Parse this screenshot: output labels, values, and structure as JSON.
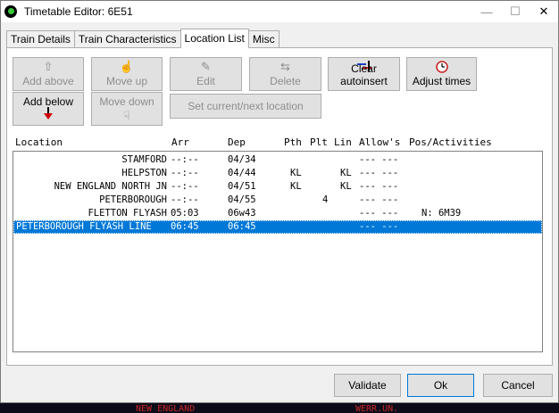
{
  "window": {
    "title": "Timetable Editor: 6E51",
    "controls": {
      "minimize": "—",
      "maximize": "☐",
      "close": "✕"
    }
  },
  "tabs": [
    {
      "label": "Train Details",
      "active": false
    },
    {
      "label": "Train Characteristics",
      "active": false
    },
    {
      "label": "Location List",
      "active": true
    },
    {
      "label": "Misc",
      "active": false
    }
  ],
  "toolbar": {
    "add_above": {
      "label": "Add above",
      "icon": "arrow-up-icon",
      "enabled": false
    },
    "add_below": {
      "label": "Add below",
      "icon": "arrow-down-red-icon",
      "enabled": true
    },
    "move_up": {
      "label": "Move up",
      "icon": "hand-up-icon",
      "enabled": false
    },
    "move_down": {
      "label": "Move down",
      "icon": "hand-down-icon",
      "enabled": false
    },
    "edit": {
      "label": "Edit",
      "icon": "edit-document-icon",
      "enabled": false
    },
    "delete": {
      "label": "Delete",
      "icon": "delete-icon",
      "enabled": false
    },
    "clear_autoinsert": {
      "label": "Clear autoinsert",
      "icon": "clear-autoinsert-icon",
      "enabled": true
    },
    "adjust_times": {
      "label": "Adjust times",
      "icon": "clock-icon",
      "enabled": true
    },
    "set_current_next": {
      "label": "Set current/next location",
      "enabled": false
    }
  },
  "columns": [
    "Location",
    "Arr",
    "Dep",
    "Pth",
    "Plt",
    "Lin",
    "Allow's",
    "Pos/Activities"
  ],
  "rows": [
    {
      "location": "STAMFORD",
      "arr": "--:--",
      "dep": "04/34",
      "pth": "",
      "plt": "",
      "lin": "",
      "allows": "--- ---",
      "pos": "",
      "selected": false
    },
    {
      "location": "HELPSTON",
      "arr": "--:--",
      "dep": "04/44",
      "pth": "KL",
      "plt": "",
      "lin": "KL",
      "allows": "--- ---",
      "pos": "",
      "selected": false
    },
    {
      "location": "NEW ENGLAND NORTH JN",
      "arr": "--:--",
      "dep": "04/51",
      "pth": "KL",
      "plt": "",
      "lin": "KL",
      "allows": "--- ---",
      "pos": "",
      "selected": false
    },
    {
      "location": "PETERBOROUGH",
      "arr": "--:--",
      "dep": "04/55",
      "pth": "",
      "plt": "4",
      "lin": "",
      "allows": "--- ---",
      "pos": "",
      "selected": false
    },
    {
      "location": "FLETTON FLYASH",
      "arr": "05:03",
      "dep": "06w43",
      "pth": "",
      "plt": "",
      "lin": "",
      "allows": "--- ---",
      "pos": "N: 6M39",
      "selected": false
    },
    {
      "location": "PETERBOROUGH FLYASH LINE",
      "arr": "06:45",
      "dep": "06:45",
      "pth": "",
      "plt": "",
      "lin": "",
      "allows": "--- ---",
      "pos": "",
      "selected": true
    }
  ],
  "footer": {
    "validate": "Validate",
    "ok": "Ok",
    "cancel": "Cancel"
  },
  "background_text": [
    "NEW ENGLAND",
    "WERR.UN."
  ]
}
